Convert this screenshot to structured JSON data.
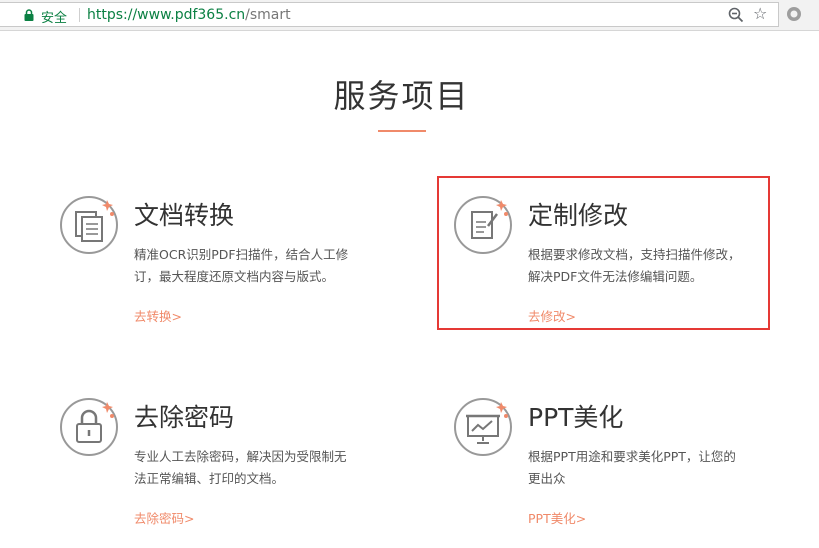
{
  "browser": {
    "security_label": "安全",
    "url_host": "https://www.pdf365.cn",
    "url_path": "/smart"
  },
  "section": {
    "title": "服务项目"
  },
  "services": [
    {
      "title": "文档转换",
      "description": "精准OCR识别PDF扫描件，结合人工修订，最大程度还原文档内容与版式。",
      "link": "去转换>",
      "icon": "document-copy-icon"
    },
    {
      "title": "定制修改",
      "description": "根据要求修改文档，支持扫描件修改，解决PDF文件无法修编辑问题。",
      "link": "去修改>",
      "icon": "edit-document-icon",
      "highlighted": true
    },
    {
      "title": "去除密码",
      "description": "专业人工去除密码，解决因为受限制无法正常编辑、打印的文档。",
      "link": "去除密码>",
      "icon": "lock-icon"
    },
    {
      "title": "PPT美化",
      "description": "根据PPT用途和要求美化PPT，让您的更出众",
      "link": "PPT美化>",
      "icon": "presentation-chart-icon"
    }
  ],
  "colors": {
    "accent": "#f08a6a",
    "highlight_border": "#e53935",
    "secure_green": "#0b8043"
  }
}
